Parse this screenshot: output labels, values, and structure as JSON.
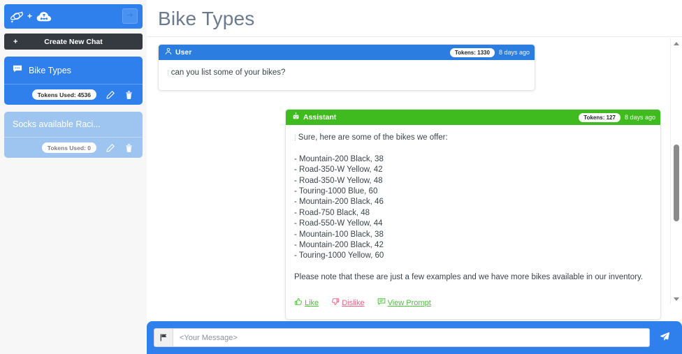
{
  "sidebar": {
    "brand": {
      "galaxy_icon": "galaxy-icon",
      "plus": "+",
      "cloud_icon": "cloud-network-icon"
    },
    "collapse_icon": "arrow-right-icon",
    "new_chat": {
      "plus": "+",
      "label": "Create New Chat"
    },
    "chats": [
      {
        "title": "Bike Types",
        "tokens_label": "Tokens Used: 4536",
        "active": true,
        "chat_icon": "chat-bubble-icon",
        "edit_icon": "pencil-icon",
        "delete_icon": "trash-icon"
      },
      {
        "title": "Socks available Raci...",
        "tokens_label": "Tokens Used: 0",
        "active": false,
        "chat_icon": "chat-bubble-icon",
        "edit_icon": "pencil-icon",
        "delete_icon": "trash-icon"
      }
    ]
  },
  "main": {
    "page_title": "Bike Types",
    "messages": {
      "user": {
        "role_label": "User",
        "role_icon": "person-icon",
        "tokens_label": "Tokens: 1330",
        "timestamp": "8 days ago",
        "text": "can you list some of your bikes?"
      },
      "assistant": {
        "role_label": "Assistant",
        "role_icon": "robot-icon",
        "tokens_label": "Tokens: 127",
        "timestamp": "8 days ago",
        "intro": "Sure, here are some of the bikes we offer:",
        "bikes": [
          "- Mountain-200 Black, 38",
          "- Road-350-W Yellow, 42",
          "- Road-350-W Yellow, 48",
          "- Touring-1000 Blue, 60",
          "- Mountain-200 Black, 46",
          "- Road-750 Black, 48",
          "- Road-550-W Yellow, 44",
          "- Mountain-100 Black, 38",
          "- Mountain-200 Black, 42",
          "- Touring-1000 Yellow, 60"
        ],
        "closing": "Please note that these are just a few examples and we have more bikes available in our inventory.",
        "feedback": {
          "like_label": "Like",
          "like_icon": "thumbs-up-icon",
          "dislike_label": "Dislike",
          "dislike_icon": "thumbs-down-icon",
          "view_prompt_label": "View Prompt",
          "view_prompt_icon": "comment-icon"
        }
      }
    }
  },
  "composer": {
    "left_icon": "flag-icon",
    "placeholder": "<Your Message>",
    "value": "",
    "send_icon": "send-paper-plane-icon"
  },
  "scrollbar": {
    "up_icon": "triangle-up-icon",
    "down_icon": "triangle-down-icon"
  },
  "colors": {
    "accent_blue": "#2f80ed",
    "user_blue": "#2b7de0",
    "assistant_green": "#3fba1f",
    "inactive_blue": "#9dc5ef",
    "dark_button": "#343a40",
    "dislike_pink": "#f2607f",
    "title_gray": "#6b7b8d"
  }
}
